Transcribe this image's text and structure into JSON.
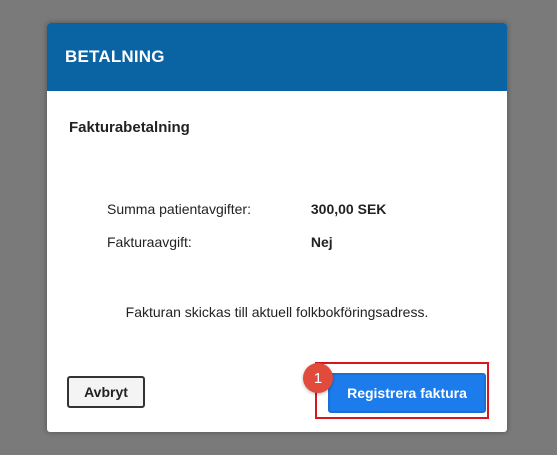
{
  "modal": {
    "title": "BETALNING",
    "section_title": "Fakturabetalning",
    "details": [
      {
        "label": "Summa patientavgifter:",
        "value": "300,00 SEK"
      },
      {
        "label": "Fakturaavgift:",
        "value": "Nej"
      }
    ],
    "notice": "Fakturan skickas till aktuell folkbokföringsadress.",
    "cancel_label": "Avbryt",
    "register_label": "Registrera faktura"
  },
  "annotation": {
    "step_number": "1"
  },
  "colors": {
    "header": "#0a64a4",
    "primary_button": "#1c7cec",
    "highlight": "#d8161e",
    "badge": "#e04b3c",
    "backdrop": "#7a7a7a"
  }
}
